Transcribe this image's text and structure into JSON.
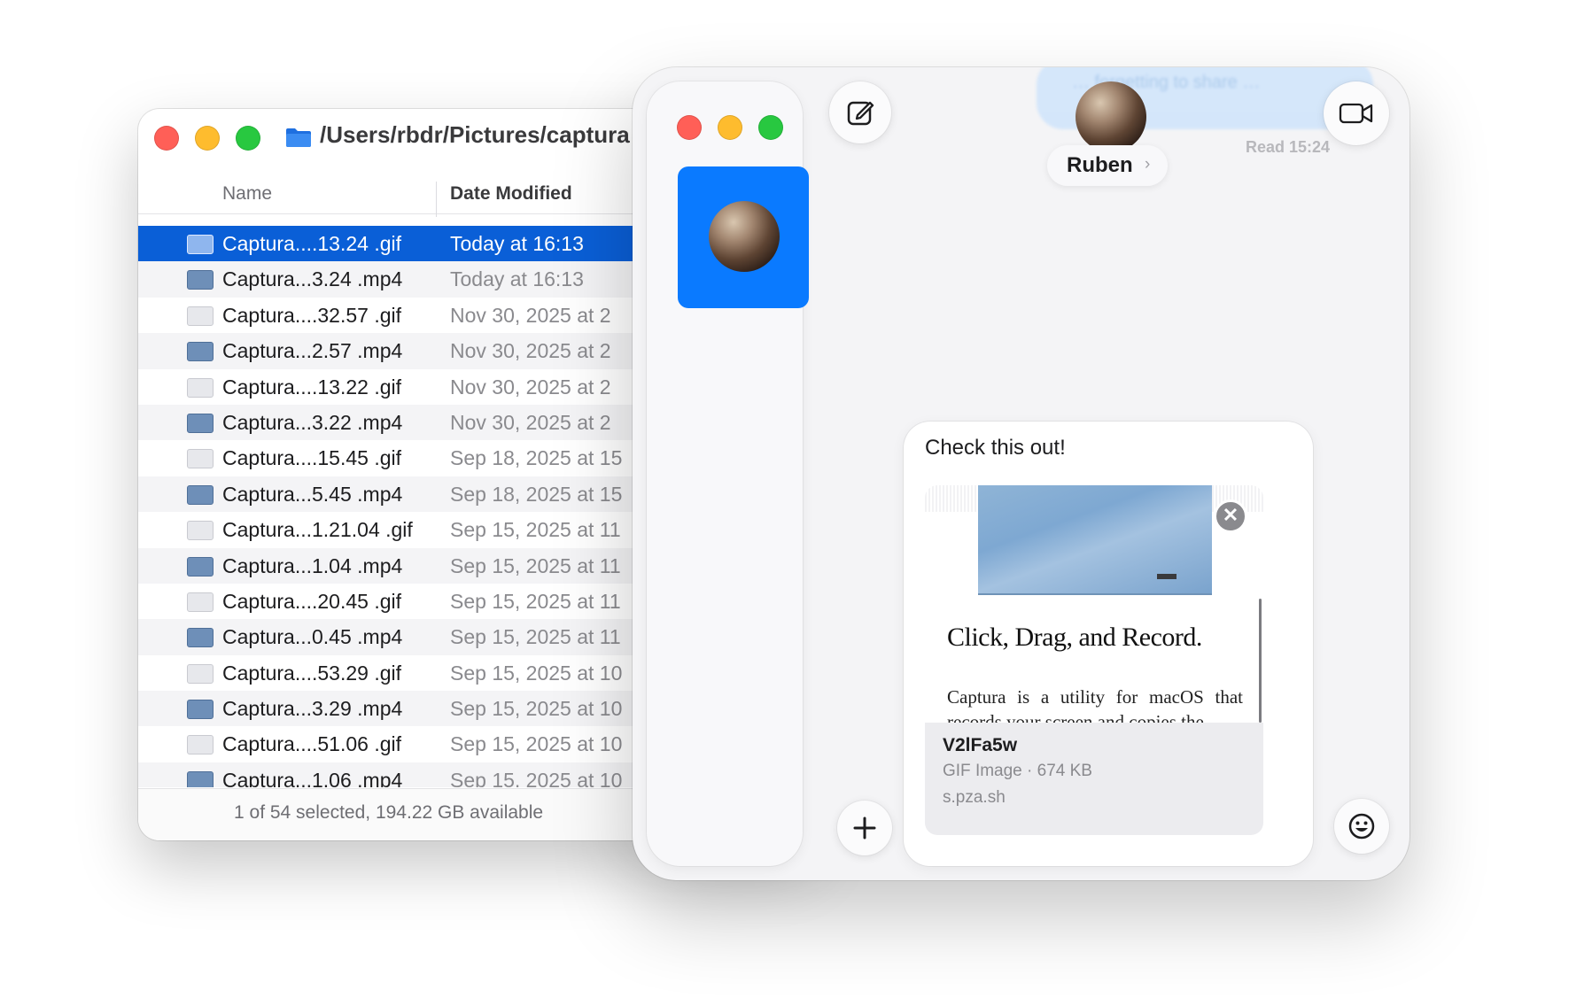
{
  "finder": {
    "path_title": "/Users/rbdr/Pictures/captura",
    "columns": {
      "name": "Name",
      "date_modified": "Date Modified"
    },
    "files": [
      {
        "name": "Captura....13.24 .gif",
        "date": "Today at 16:13",
        "kind": "gif",
        "selected": true
      },
      {
        "name": "Captura...3.24 .mp4",
        "date": "Today at 16:13",
        "kind": "mp4"
      },
      {
        "name": "Captura....32.57 .gif",
        "date": "Nov 30, 2025 at 2",
        "kind": "gif"
      },
      {
        "name": "Captura...2.57 .mp4",
        "date": "Nov 30, 2025 at 2",
        "kind": "mp4"
      },
      {
        "name": "Captura....13.22 .gif",
        "date": "Nov 30, 2025 at 2",
        "kind": "gif"
      },
      {
        "name": "Captura...3.22 .mp4",
        "date": "Nov 30, 2025 at 2",
        "kind": "mp4"
      },
      {
        "name": "Captura....15.45 .gif",
        "date": "Sep 18, 2025 at 15",
        "kind": "gif"
      },
      {
        "name": "Captura...5.45 .mp4",
        "date": "Sep 18, 2025 at 15",
        "kind": "mp4"
      },
      {
        "name": "Captura...1.21.04 .gif",
        "date": "Sep 15, 2025 at 11",
        "kind": "gif"
      },
      {
        "name": "Captura...1.04 .mp4",
        "date": "Sep 15, 2025 at 11",
        "kind": "mp4"
      },
      {
        "name": "Captura....20.45 .gif",
        "date": "Sep 15, 2025 at 11",
        "kind": "gif"
      },
      {
        "name": "Captura...0.45 .mp4",
        "date": "Sep 15, 2025 at 11",
        "kind": "mp4"
      },
      {
        "name": "Captura....53.29 .gif",
        "date": "Sep 15, 2025 at 10",
        "kind": "gif"
      },
      {
        "name": "Captura...3.29 .mp4",
        "date": "Sep 15, 2025 at 10",
        "kind": "mp4"
      },
      {
        "name": "Captura....51.06 .gif",
        "date": "Sep 15, 2025 at 10",
        "kind": "gif"
      },
      {
        "name": "Captura...1.06 .mp4",
        "date": "Sep 15, 2025 at 10",
        "kind": "mp4"
      }
    ],
    "status": "1 of 54 selected, 194.22 GB available"
  },
  "messages": {
    "contact_name": "Ruben",
    "read_receipt": "Read 15:24",
    "previous_bubble_text": "… forgetting to share …",
    "composer_text": "Check this out!",
    "attachment": {
      "preview_heading": "Click, Drag, and Record.",
      "preview_body": "Captura is a utility for macOS that records your screen and copies the",
      "name": "V2lFa5w",
      "meta": "GIF Image · 674 KB",
      "source": "s.pza.sh",
      "remove_glyph": "✕"
    },
    "icons": {
      "compose": "compose-icon",
      "video": "video-camera-icon",
      "plus": "plus-icon",
      "emoji": "emoji-icon"
    }
  },
  "colors": {
    "selection": "#0a5fd7",
    "conversation_tile": "#0a7aff",
    "close": "#ff5f57",
    "minimize": "#febc2e",
    "zoom": "#28c840"
  }
}
